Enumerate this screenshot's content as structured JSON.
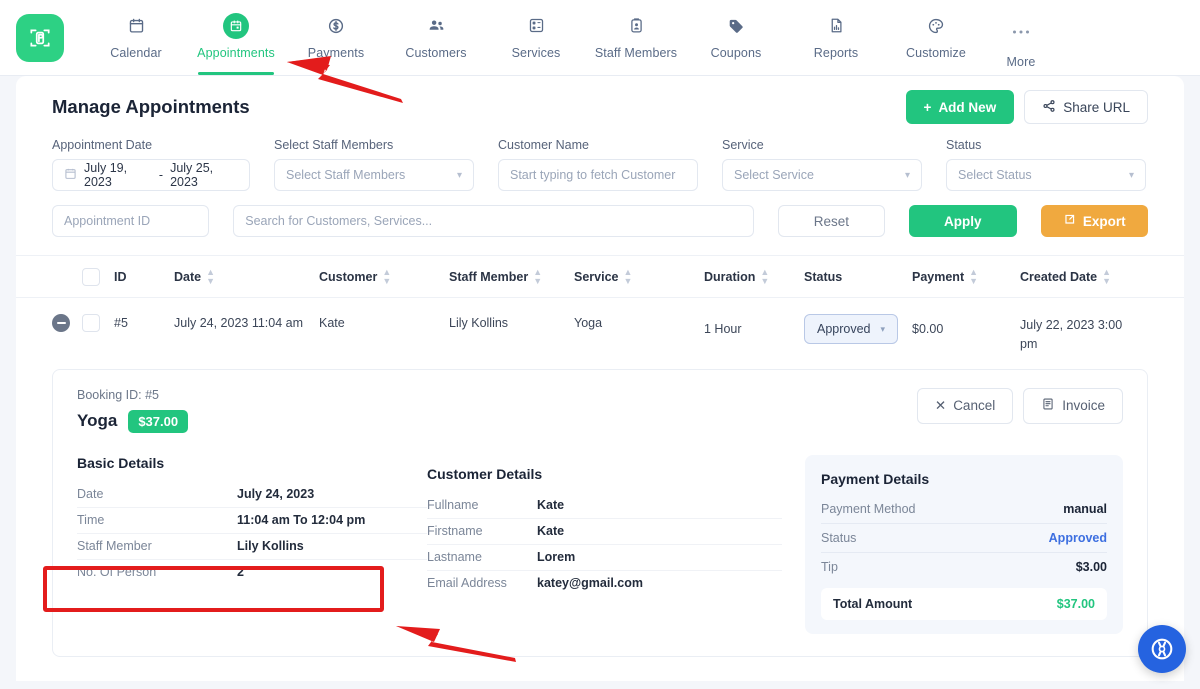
{
  "nav": {
    "logo_icon": "bookly-logo-icon",
    "items": [
      {
        "label": "Calendar",
        "icon": "calendar-icon",
        "active": false
      },
      {
        "label": "Appointments",
        "icon": "appointments-icon",
        "active": true
      },
      {
        "label": "Payments",
        "icon": "dollar-icon",
        "active": false
      },
      {
        "label": "Customers",
        "icon": "customers-icon",
        "active": false
      },
      {
        "label": "Services",
        "icon": "services-grid-icon",
        "active": false
      },
      {
        "label": "Staff Members",
        "icon": "id-badge-icon",
        "active": false
      },
      {
        "label": "Coupons",
        "icon": "tag-icon",
        "active": false
      },
      {
        "label": "Reports",
        "icon": "report-file-icon",
        "active": false
      },
      {
        "label": "Customize",
        "icon": "palette-icon",
        "active": false
      },
      {
        "label": "More",
        "icon": "ellipsis-icon",
        "active": false
      }
    ]
  },
  "header": {
    "title": "Manage Appointments",
    "add_new_label": "Add New",
    "share_url_label": "Share URL"
  },
  "filters": {
    "appointment_date_label": "Appointment Date",
    "appointment_date_start": "July 19, 2023",
    "appointment_date_sep": "-",
    "appointment_date_end": "July 25, 2023",
    "staff_label": "Select Staff Members",
    "staff_placeholder": "Select Staff Members",
    "customer_label": "Customer Name",
    "customer_placeholder": "Start typing to fetch Customer",
    "service_label": "Service",
    "service_placeholder": "Select Service",
    "status_label": "Status",
    "status_placeholder": "Select Status",
    "appointment_id_placeholder": "Appointment ID",
    "search_placeholder": "Search for Customers, Services...",
    "reset_label": "Reset",
    "apply_label": "Apply",
    "export_label": "Export"
  },
  "table": {
    "columns": [
      {
        "label": "ID",
        "sortable": false
      },
      {
        "label": "Date",
        "sortable": true
      },
      {
        "label": "Customer",
        "sortable": true
      },
      {
        "label": "Staff Member",
        "sortable": true
      },
      {
        "label": "Service",
        "sortable": true
      },
      {
        "label": "Duration",
        "sortable": true
      },
      {
        "label": "Status",
        "sortable": false
      },
      {
        "label": "Payment",
        "sortable": true
      },
      {
        "label": "Created Date",
        "sortable": true
      }
    ],
    "rows": [
      {
        "id": "#5",
        "date": "July 24, 2023 11:04 am",
        "customer": "Kate",
        "staff": "Lily Kollins",
        "service": "Yoga",
        "duration": "1 Hour",
        "status": "Approved",
        "payment": "$0.00",
        "created": "July 22, 2023 3:00 pm"
      }
    ]
  },
  "detail": {
    "booking_id": "Booking ID: #5",
    "service_name": "Yoga",
    "price_badge": "$37.00",
    "cancel_label": "Cancel",
    "invoice_label": "Invoice",
    "basic": {
      "title": "Basic Details",
      "rows": [
        {
          "key": "Date",
          "value": "July 24, 2023"
        },
        {
          "key": "Time",
          "value": "11:04 am To 12:04 pm"
        },
        {
          "key": "Staff Member",
          "value": "Lily Kollins"
        },
        {
          "key": "No. Of Person",
          "value": "2"
        }
      ]
    },
    "customer": {
      "title": "Customer Details",
      "rows": [
        {
          "key": "Fullname",
          "value": "Kate"
        },
        {
          "key": "Firstname",
          "value": "Kate"
        },
        {
          "key": "Lastname",
          "value": "Lorem"
        },
        {
          "key": "Email Address",
          "value": "katey@gmail.com"
        }
      ]
    },
    "payment": {
      "title": "Payment Details",
      "rows": [
        {
          "key": "Payment Method",
          "value": "manual"
        },
        {
          "key": "Status",
          "value": "Approved"
        },
        {
          "key": "Tip",
          "value": "$3.00"
        }
      ],
      "total_key": "Total Amount",
      "total_value": "$37.00"
    }
  },
  "help": {
    "icon": "lifebuoy-icon"
  },
  "colors": {
    "brand_green": "#22c57f",
    "export_orange": "#f0a93f",
    "annotation_red": "#e31c1c",
    "help_blue": "#2563e0",
    "status_blue_text": "#3d6fe0"
  }
}
